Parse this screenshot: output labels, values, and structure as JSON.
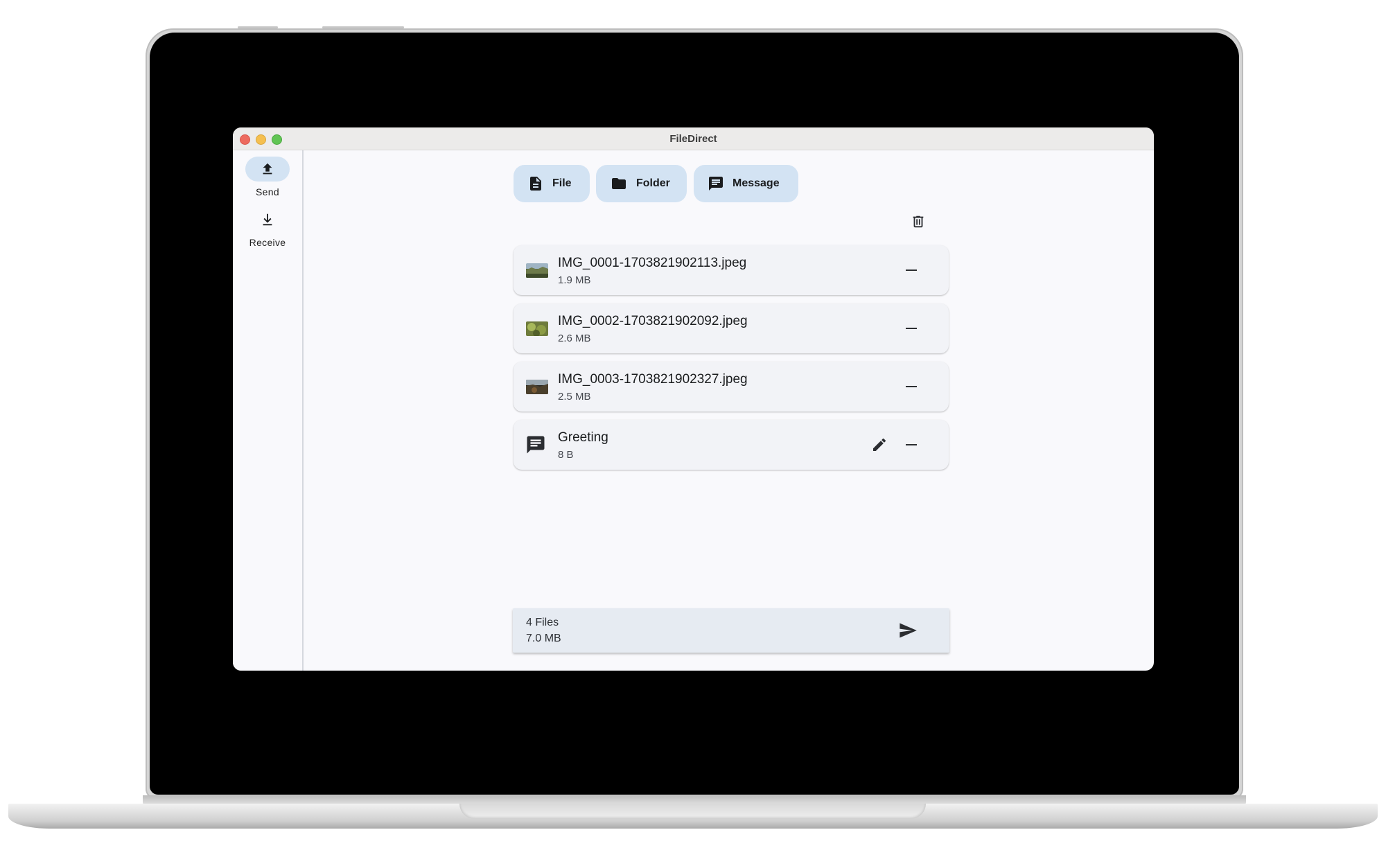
{
  "window": {
    "title": "FileDirect"
  },
  "colors": {
    "accent_container": "#d3e3f3",
    "window_bg": "#f9f9fc",
    "card_bg": "#f2f3f7",
    "summary_bg": "#e6ebf2"
  },
  "nav": {
    "items": [
      {
        "label": "Send",
        "icon": "upload-icon",
        "active": true
      },
      {
        "label": "Receive",
        "icon": "download-icon",
        "active": false
      }
    ]
  },
  "actions": [
    {
      "label": "File",
      "icon": "file-icon"
    },
    {
      "label": "Folder",
      "icon": "folder-icon"
    },
    {
      "label": "Message",
      "icon": "message-icon"
    }
  ],
  "clear_icon": "trash-icon",
  "files": [
    {
      "name": "IMG_0001-1703821902113.jpeg",
      "size": "1.9 MB",
      "kind": "image"
    },
    {
      "name": "IMG_0002-1703821902092.jpeg",
      "size": "2.6 MB",
      "kind": "image"
    },
    {
      "name": "IMG_0003-1703821902327.jpeg",
      "size": "2.5 MB",
      "kind": "image"
    },
    {
      "name": "Greeting",
      "size": "8 B",
      "kind": "message"
    }
  ],
  "summary": {
    "count": "4 Files",
    "size": "7.0 MB",
    "send_icon": "send-icon"
  }
}
